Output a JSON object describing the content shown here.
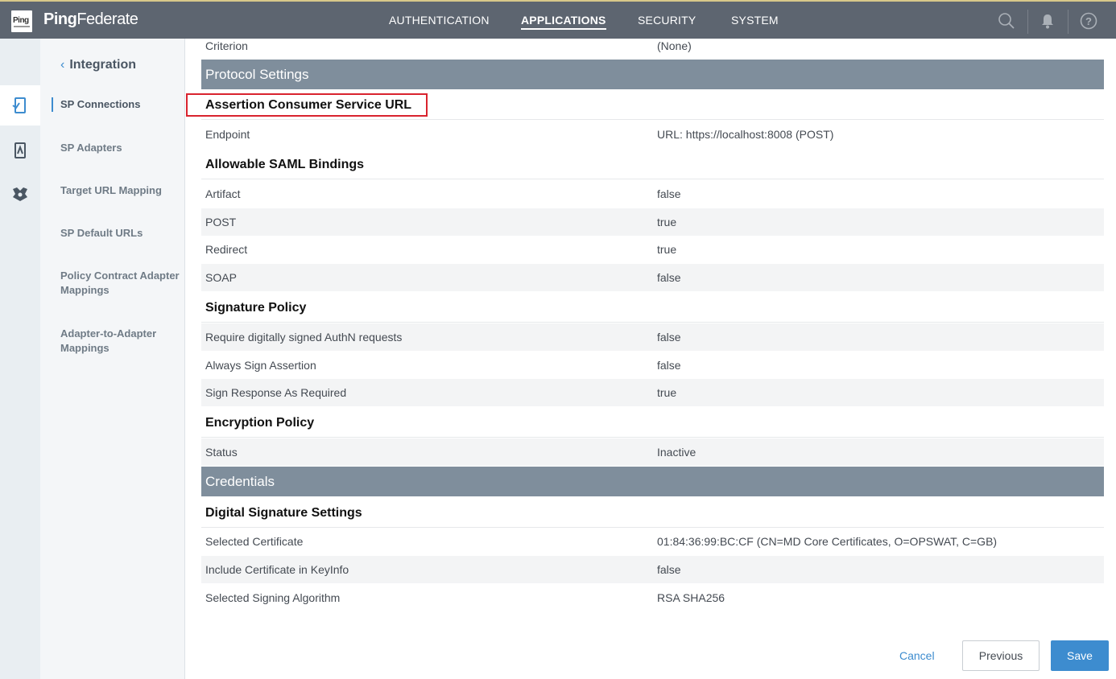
{
  "app": {
    "logo_text": "Ping",
    "brand_prefix": "Ping",
    "brand_suffix": "Federate"
  },
  "topnav": [
    {
      "label": "AUTHENTICATION"
    },
    {
      "label": "APPLICATIONS",
      "active": true
    },
    {
      "label": "SECURITY"
    },
    {
      "label": "SYSTEM"
    }
  ],
  "icons": {
    "search": "search-icon",
    "notifications": "bell-icon",
    "help": "help-icon"
  },
  "subnav": {
    "title": "Integration",
    "items": [
      {
        "label": "SP Connections",
        "active": true
      },
      {
        "label": "SP Adapters"
      },
      {
        "label": "Target URL Mapping"
      },
      {
        "label": "SP Default URLs"
      },
      {
        "label": "Policy Contract Adapter Mappings"
      },
      {
        "label": "Adapter-to-Adapter Mappings"
      }
    ]
  },
  "content": {
    "criterion": {
      "label": "Criterion",
      "value": "(None)"
    },
    "protocol_settings": "Protocol Settings",
    "acs_url": {
      "heading": "Assertion Consumer Service URL",
      "endpoint_label": "Endpoint",
      "endpoint_value": "URL: https://localhost:8008 (POST)"
    },
    "saml_bindings": {
      "heading": "Allowable SAML Bindings",
      "rows": [
        {
          "label": "Artifact",
          "value": "false"
        },
        {
          "label": "POST",
          "value": "true"
        },
        {
          "label": "Redirect",
          "value": "true"
        },
        {
          "label": "SOAP",
          "value": "false"
        }
      ]
    },
    "signature_policy": {
      "heading": "Signature Policy",
      "rows": [
        {
          "label": "Require digitally signed AuthN requests",
          "value": "false"
        },
        {
          "label": "Always Sign Assertion",
          "value": "false"
        },
        {
          "label": "Sign Response As Required",
          "value": "true"
        }
      ]
    },
    "encryption_policy": {
      "heading": "Encryption Policy",
      "rows": [
        {
          "label": "Status",
          "value": "Inactive"
        }
      ]
    },
    "credentials": "Credentials",
    "digital_signature": {
      "heading": "Digital Signature Settings",
      "rows": [
        {
          "label": "Selected Certificate",
          "value": "01:84:36:99:BC:CF (CN=MD Core Certificates, O=OPSWAT, C=GB)"
        },
        {
          "label": "Include Certificate in KeyInfo",
          "value": "false"
        },
        {
          "label": "Selected Signing Algorithm",
          "value": "RSA SHA256"
        }
      ]
    }
  },
  "footer": {
    "cancel": "Cancel",
    "previous": "Previous",
    "save": "Save"
  },
  "colors": {
    "topbar": "#5d6570",
    "accent": "#3d8ccf",
    "section_header": "#7f8e9c",
    "highlight_box": "#d9232e"
  }
}
